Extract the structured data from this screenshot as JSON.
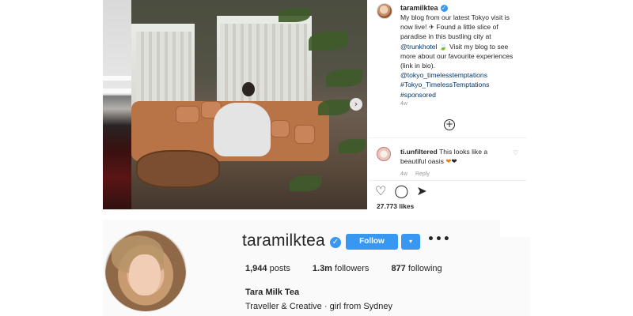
{
  "post": {
    "username": "taramilktea",
    "caption": {
      "line1": "My blog from our latest Tokyo visit is now live! ✈ Found a little slice of paradise in this bustling city at",
      "mention": "@trunkhotel",
      "leaf": "🍃",
      "line2": "Visit my blog to see more about our favourite experiences (link in bio).",
      "tag1": "@tokyo_timelesstemptations",
      "tag2": "#Tokyo_TimelessTemptations",
      "tag3": "#sponsored"
    },
    "time": "4w",
    "comment": {
      "username": "ti.unfiltered",
      "text": "This looks like a beautiful oasis",
      "heart_orange": "❤",
      "heart_black": "❤",
      "time": "4w",
      "reply_label": "Reply"
    },
    "likes": "27.773 likes",
    "icons": [
      "heart-icon",
      "comment-icon",
      "share-icon",
      "add-icon",
      "chevron-right-icon",
      "verified-icon"
    ]
  },
  "profile": {
    "username": "taramilktea",
    "follow_label": "Follow",
    "dropdown_symbol": "▾",
    "more_symbol": "•••",
    "stats": {
      "posts_count": "1,944",
      "posts_label": "posts",
      "followers_count": "1.3m",
      "followers_label": "followers",
      "following_count": "877",
      "following_label": "following"
    },
    "full_name": "Tara Milk Tea",
    "bio": "Traveller & Creative · girl from Sydney"
  },
  "colors": {
    "accent": "#3897f0",
    "tag_link": "#00376b",
    "text": "#262626",
    "muted": "#999999"
  }
}
